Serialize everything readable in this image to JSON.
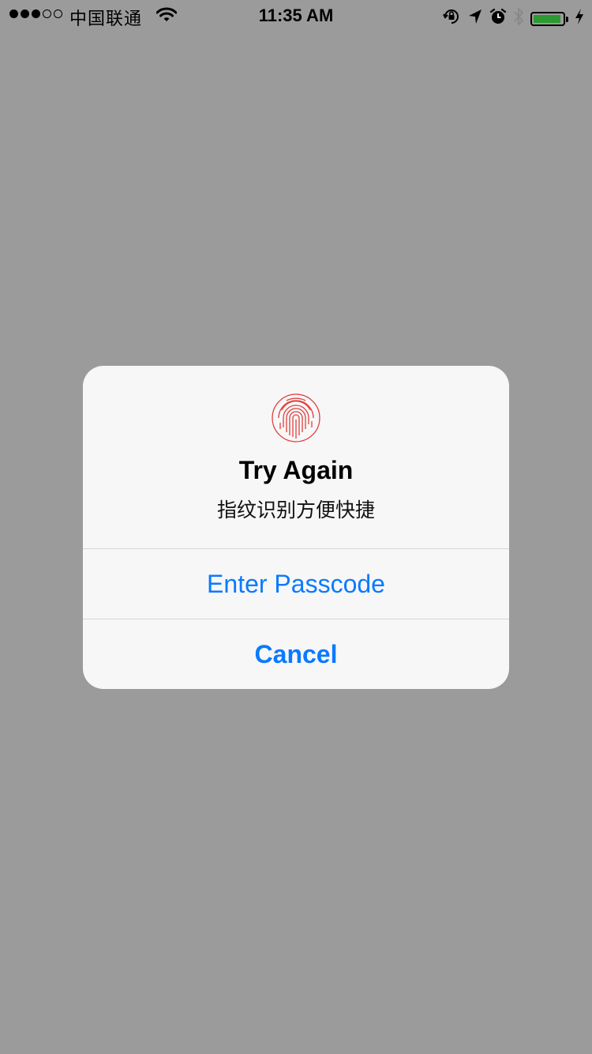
{
  "status_bar": {
    "carrier": "中国联通",
    "time": "11:35 AM",
    "signal_bars_filled": 3,
    "signal_bars_total": 5,
    "battery_level": 0.95,
    "battery_color": "#2c9a31",
    "icons": [
      "orientation-lock-icon",
      "location-arrow-icon",
      "alarm-icon",
      "bluetooth-icon",
      "battery-icon",
      "charging-bolt-icon"
    ]
  },
  "alert": {
    "icon": "fingerprint-icon",
    "icon_color": "#e0403f",
    "title": "Try Again",
    "message": "指纹识别方便快捷",
    "buttons": [
      {
        "label": "Enter Passcode",
        "style": "default"
      },
      {
        "label": "Cancel",
        "style": "cancel"
      }
    ],
    "accent_color": "#0a7aff"
  }
}
